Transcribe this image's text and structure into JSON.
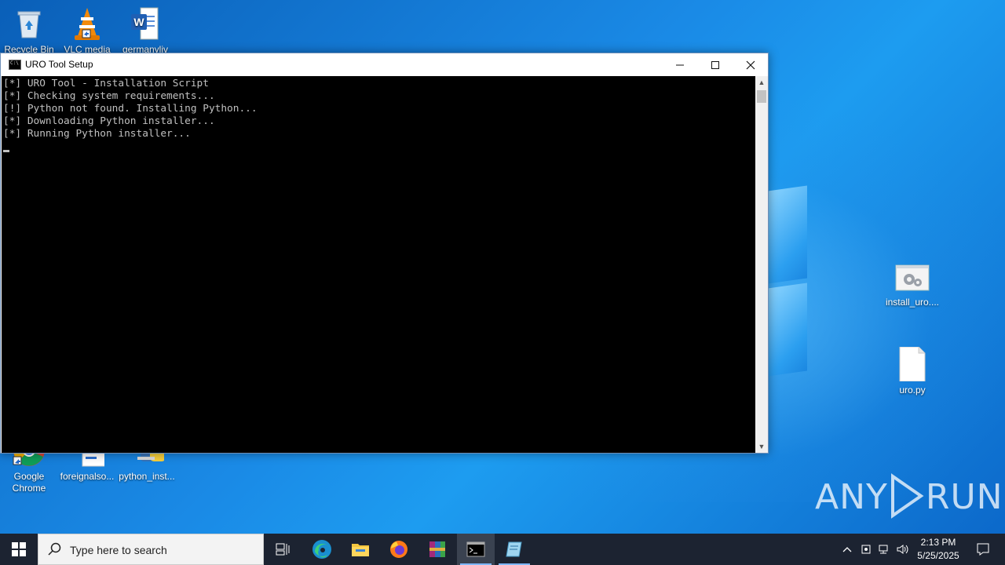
{
  "desktop": {
    "icons_top": [
      {
        "label": "Recycle Bin"
      },
      {
        "label": "VLC media"
      },
      {
        "label": "germanyliv"
      }
    ],
    "icons_bottom": [
      {
        "label": "Google Chrome"
      },
      {
        "label": "foreignalso..."
      },
      {
        "label": "python_inst..."
      }
    ],
    "icons_right": [
      {
        "label": "install_uro...."
      },
      {
        "label": "uro.py"
      }
    ],
    "watermark": "ANY RUN"
  },
  "console": {
    "title": "URO Tool Setup",
    "lines": [
      "[*] URO Tool - Installation Script",
      "[*] Checking system requirements...",
      "[!] Python not found. Installing Python...",
      "[*] Downloading Python installer...",
      "[*] Running Python installer..."
    ]
  },
  "taskbar": {
    "search_placeholder": "Type here to search",
    "time": "2:13 PM",
    "date": "5/25/2025",
    "apps": [
      "task-view",
      "edge",
      "file-explorer",
      "firefox",
      "winrar",
      "command-prompt",
      "notepad"
    ]
  }
}
